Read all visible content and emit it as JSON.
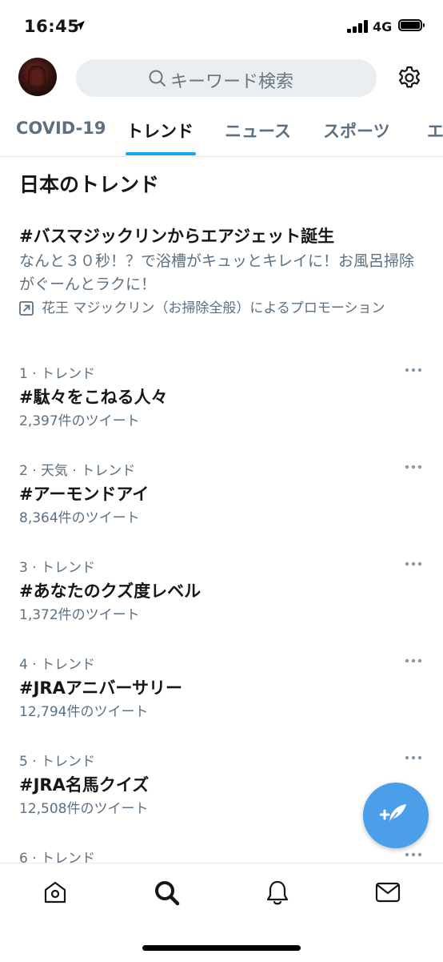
{
  "status_bar": {
    "time": "16:45",
    "network": "4G"
  },
  "header": {
    "search_placeholder": "キーワード検索"
  },
  "tabs": [
    {
      "label": "COVID-19",
      "active": false
    },
    {
      "label": "トレンド",
      "active": true
    },
    {
      "label": "ニュース",
      "active": false
    },
    {
      "label": "スポーツ",
      "active": false
    },
    {
      "label": "エ",
      "active": false
    }
  ],
  "section": {
    "title": "日本のトレンド"
  },
  "promo": {
    "title": "#バスマジックリンからエアジェット誕生",
    "description": "なんと３０秒！？で浴槽がキュッとキレイに！お風呂掃除がぐーんとラクに！",
    "promoted_by": "花王 マジックリン（お掃除全般）によるプロモーション"
  },
  "trends": [
    {
      "meta": "1 · トレンド",
      "name": "#駄々をこねる人々",
      "count": "2,397件のツイート"
    },
    {
      "meta": "2 · 天気 · トレンド",
      "name": "#アーモンドアイ",
      "count": "8,364件のツイート"
    },
    {
      "meta": "3 · トレンド",
      "name": "#あなたのクズ度レベル",
      "count": "1,372件のツイート"
    },
    {
      "meta": "4 · トレンド",
      "name": "#JRAアニバーサリー",
      "count": "12,794件のツイート"
    },
    {
      "meta": "5 · トレンド",
      "name": "#JRA名馬クイズ",
      "count": "12,508件のツイート"
    },
    {
      "meta": "6 · トレンド",
      "name": "",
      "count": ""
    }
  ],
  "colors": {
    "accent": "#1da1f2",
    "fab": "#4a9fe8",
    "secondary_text": "#5b7083"
  },
  "icons": {
    "bottom_nav": [
      "home-icon",
      "search-icon",
      "bell-icon",
      "mail-icon"
    ],
    "fab": "compose-feather-icon"
  }
}
